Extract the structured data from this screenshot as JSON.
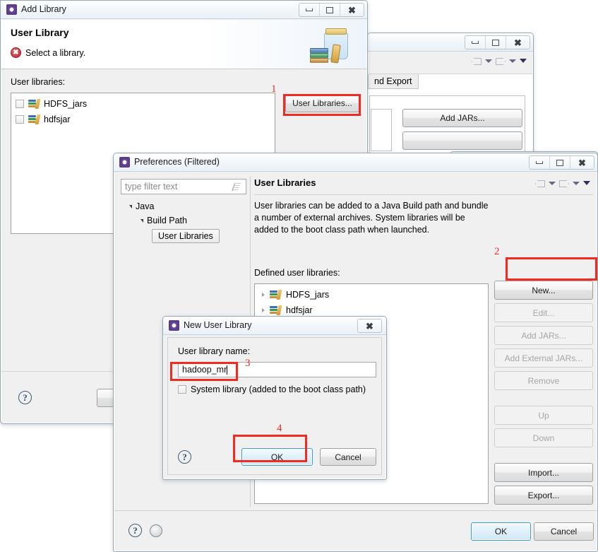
{
  "background_window_a": {
    "toolbar": {
      "back_icon": "arrow-left-icon",
      "forward_icon": "arrow-right-icon",
      "menu_icon": "chevron-down-icon"
    },
    "tab_label": "nd Export",
    "buttons": [
      "Add JARs..."
    ]
  },
  "background_window_b": {
    "title": "",
    "toolbar": {
      "back_icon": "arrow-left-icon",
      "forward_icon": "arrow-right-icon",
      "menu_icon": "chevron-down-icon"
    }
  },
  "add_library_dialog": {
    "title": "Add Library",
    "window_icon": "eclipse-icon",
    "controls": {
      "minimize": "minimize-icon",
      "maximize": "maximize-icon",
      "close": "close-icon"
    },
    "heading": "User Library",
    "message": "Select a library.",
    "message_icon": "error-icon",
    "banner_icon": "jar-with-books-icon",
    "list_label": "User libraries:",
    "libraries": [
      {
        "name": "HDFS_jars",
        "checked": false
      },
      {
        "name": "hdfsjar",
        "checked": false
      }
    ],
    "user_libraries_button": "User Libraries...",
    "help_icon": "help-icon"
  },
  "preferences_dialog": {
    "title": "Preferences (Filtered)",
    "window_icon": "eclipse-icon",
    "controls": {
      "minimize": "minimize-icon",
      "maximize": "maximize-icon",
      "close": "close-icon"
    },
    "filter": {
      "value": "",
      "placeholder": "type filter text",
      "clear_icon": "pencil-icon"
    },
    "tree": [
      {
        "label": "Java",
        "indent": 0,
        "expanded": true,
        "selected": false
      },
      {
        "label": "Build Path",
        "indent": 1,
        "expanded": true,
        "selected": false
      },
      {
        "label": "User Libraries",
        "indent": 2,
        "expanded": false,
        "selected": true
      }
    ],
    "page_title": "User Libraries",
    "page_nav": {
      "back_icon": "arrow-left-icon",
      "forward_icon": "arrow-right-icon",
      "menu_icon": "chevron-down-icon"
    },
    "description": "User libraries can be added to a Java Build path and bundle a number of external archives. System libraries will be added to the boot class path when launched.",
    "defined_label": "Defined user libraries:",
    "defined_libraries": [
      {
        "name": "HDFS_jars"
      },
      {
        "name": "hdfsjar"
      }
    ],
    "side_buttons": [
      {
        "label": "New...",
        "enabled": true,
        "gap_after": false
      },
      {
        "label": "Edit...",
        "enabled": false,
        "gap_after": false
      },
      {
        "label": "Add JARs...",
        "enabled": false,
        "gap_after": false
      },
      {
        "label": "Add External JARs...",
        "enabled": false,
        "gap_after": false
      },
      {
        "label": "Remove",
        "enabled": false,
        "gap_after": true
      },
      {
        "label": "Up",
        "enabled": false,
        "gap_after": false
      },
      {
        "label": "Down",
        "enabled": false,
        "gap_after": true
      },
      {
        "label": "Import...",
        "enabled": true,
        "gap_after": false
      },
      {
        "label": "Export...",
        "enabled": true,
        "gap_after": false
      }
    ],
    "footer": {
      "help_icon": "help-icon",
      "restore_icon": "restore-defaults-icon",
      "ok_label": "OK",
      "cancel_label": "Cancel"
    }
  },
  "new_user_library_dialog": {
    "title": "New User Library",
    "window_icon": "eclipse-icon",
    "close_icon": "close-icon",
    "name_label": "User library name:",
    "name_value": "hadoop_mr",
    "system_library_label": "System library (added to the boot class path)",
    "system_library_checked": false,
    "help_icon": "help-icon",
    "ok_label": "OK",
    "cancel_label": "Cancel"
  },
  "annotations": [
    {
      "number": "1",
      "target": "user-libraries-button"
    },
    {
      "number": "2",
      "target": "new-button"
    },
    {
      "number": "3",
      "target": "library-name-field"
    },
    {
      "number": "4",
      "target": "ok-button"
    }
  ],
  "colors": {
    "annotation": "#f22a1f",
    "accent": "#3c9fd4"
  }
}
